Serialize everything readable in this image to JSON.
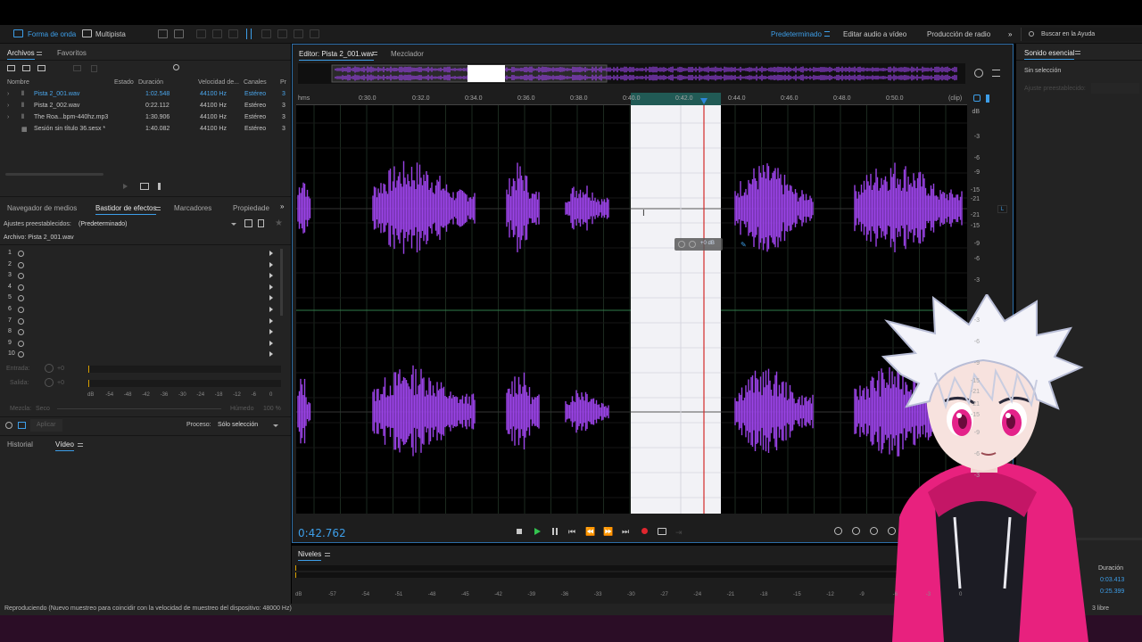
{
  "toolbar": {
    "waveform": "Forma de onda",
    "multitrack": "Multipista",
    "workspace": "Predeterminado",
    "edit_video": "Editar audio a vídeo",
    "radio": "Producción de radio",
    "search_placeholder": "Buscar en la Ayuda"
  },
  "files_panel": {
    "tab_files": "Archivos",
    "tab_favorites": "Favoritos",
    "columns": [
      "Nombre",
      "Estado",
      "Duración",
      "Velocidad de...",
      "Canales",
      "Pr"
    ],
    "rows": [
      {
        "name": "Pista 2_001.wav",
        "duration": "1:02.548",
        "rate": "44100 Hz",
        "channels": "Estéreo",
        "extra": "3"
      },
      {
        "name": "Pista 2_002.wav",
        "duration": "0:22.112",
        "rate": "44100 Hz",
        "channels": "Estéreo",
        "extra": "3"
      },
      {
        "name": "The Roa...bpm-440hz.mp3",
        "duration": "1:30.906",
        "rate": "44100 Hz",
        "channels": "Estéreo",
        "extra": "3"
      },
      {
        "name": "Sesión sin título 36.sesx *",
        "duration": "1:40.082",
        "rate": "44100 Hz",
        "channels": "Estéreo",
        "extra": "3"
      }
    ]
  },
  "effects_panel": {
    "tabs": [
      "Navegador de medios",
      "Bastidor de efectos",
      "Marcadores",
      "Propiedade"
    ],
    "presets_label": "Ajustes preestablecidos:",
    "presets_value": "(Predeterminado)",
    "file_label": "Archivo: Pista 2_001.wav",
    "slots": [
      "1",
      "2",
      "3",
      "4",
      "5",
      "6",
      "7",
      "8",
      "9",
      "10"
    ],
    "input_label": "Entrada:",
    "output_label": "Salida:",
    "db_val": "+0",
    "meter_ticks": [
      "dB",
      "-54",
      "-48",
      "-42",
      "-36",
      "-30",
      "-24",
      "-18",
      "-12",
      "-6",
      "0"
    ],
    "mix_label": "Mezcla:",
    "dry": "Seco",
    "wet": "Húmedo",
    "pct": "100 %",
    "apply": "Aplicar",
    "process_label": "Proceso:",
    "process_value": "Sólo selección"
  },
  "history": {
    "tab_history": "Historial",
    "tab_video": "Vídeo"
  },
  "editor": {
    "tab_editor": "Editor: Pista 2_001.wav",
    "tab_mixer": "Mezclador",
    "time_labels": [
      "hms",
      "0:30.0",
      "0:32.0",
      "0:34.0",
      "0:36.0",
      "0:38.0",
      "0:40.0",
      "0:42.0",
      "0:44.0",
      "0:46.0",
      "0:48.0",
      "0:50.0",
      "(clip)"
    ],
    "db_labels_top": [
      "dB",
      "-3",
      "-6",
      "-9",
      "-15",
      "-21",
      "-21",
      "-15",
      "-9",
      "-6",
      "-3"
    ],
    "db_labels_bottom": [
      "-3",
      "-6",
      "-9",
      "-15",
      "-21",
      "-21",
      "-15",
      "-9",
      "-6",
      "-3"
    ],
    "channel_L": "L",
    "channel_R": "R",
    "hud_db": "+0 dB",
    "current_time": "0:42.762"
  },
  "levels": {
    "title": "Niveles",
    "ticks": [
      "dB",
      "-57",
      "-54",
      "-51",
      "-48",
      "-45",
      "-42",
      "-39",
      "-36",
      "-33",
      "-30",
      "-27",
      "-24",
      "-21",
      "-18",
      "-15",
      "-12",
      "-9",
      "-6",
      "-3",
      "0"
    ]
  },
  "essential_sound": {
    "title": "Sonido esencial",
    "no_selection": "Sin selección",
    "presets": "Ajuste preestablecido:"
  },
  "selection_info": {
    "duration_label": "Duración",
    "duration_value": "0:03.413",
    "total_value": "0:25.399"
  },
  "status": {
    "text": "Reproduciendo (Nuevo muestreo para coincidir con la velocidad de muestreo del dispositivo: 48000 Hz)",
    "free": "3 libre"
  },
  "colors": {
    "waveform": "#9a43e6",
    "accent": "#3d9ee8",
    "selection": "#f2f2f6",
    "playhead": "#d32a2a",
    "character_hoodie": "#e8217e"
  }
}
